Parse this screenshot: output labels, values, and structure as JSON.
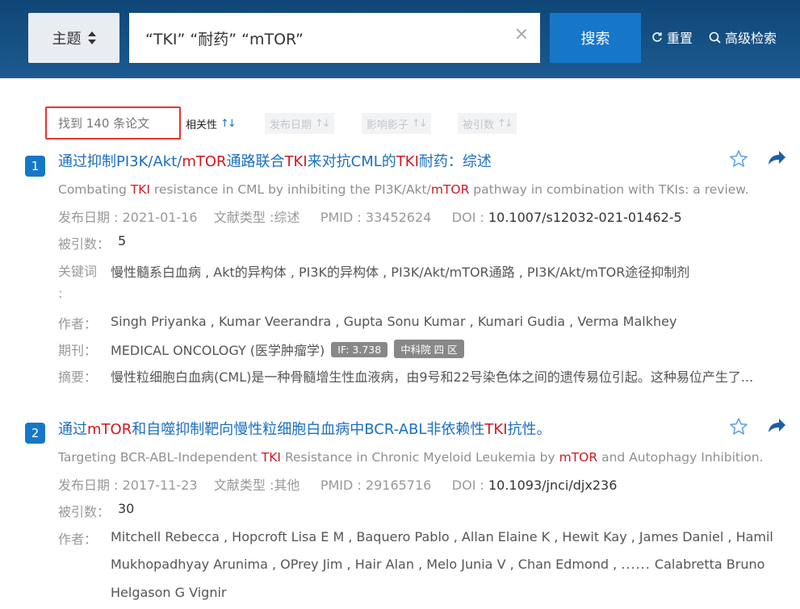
{
  "header": {
    "field_select": "主题",
    "query": "“TKI” “耐药” “mTOR”",
    "search_button": "搜索",
    "reset": "重置",
    "advanced": "高级检索"
  },
  "results_bar": {
    "count_text": "找到 140 条论文",
    "sorts": [
      {
        "label": "相关性",
        "active": true
      },
      {
        "label": "发布日期",
        "active": false
      },
      {
        "label": "影响影子",
        "active": false
      },
      {
        "label": "被引数",
        "active": false
      }
    ]
  },
  "items": [
    {
      "num": "1",
      "title_parts": [
        "通过抑制PI3K/Akt/",
        "mTOR",
        "通路联合",
        "TKI",
        "来对抗CML的",
        "TKI",
        "耐药：综述"
      ],
      "subtitle_parts": [
        "Combating ",
        "TKI",
        " resistance in CML by inhibiting the PI3K/Akt/",
        "mTOR",
        " pathway in combination with TKIs: a review."
      ],
      "pub_date_label": "发布日期 : ",
      "pub_date": "2021-01-16",
      "doc_type_label": "文献类型 :",
      "doc_type": "综述",
      "pmid_label": "PMID : ",
      "pmid": "33452624",
      "doi_label": "DOI : ",
      "doi": "10.1007/s12032-021-01462-5",
      "cited_label": "被引数：",
      "cited": "5",
      "keywords_label": "关键词",
      "keywords_colon": ":",
      "keywords": "慢性髓系白血病 , Akt的异构体 , PI3K的异构体 , PI3K/Akt/mTOR通路 , PI3K/Akt/mTOR途径抑制剂",
      "authors_label": "作者：",
      "authors": "Singh Priyanka , Kumar Veerandra , Gupta Sonu Kumar , Kumari Gudia , Verma Malkhey",
      "journal_label": "期刊：",
      "journal": "MEDICAL ONCOLOGY (医学肿瘤学)",
      "tag_if": "IF: 3.738",
      "tag_cas": "中科院 四 区",
      "abstract_label": "摘要：",
      "abstract": "慢性粒细胞白血病(CML)是一种骨髓增生性血液病，由9号和22号染色体之间的遗传易位引起。这种易位产生了..."
    },
    {
      "num": "2",
      "title_parts": [
        "通过",
        "mTOR",
        "和自噬抑制靶向慢性粒细胞白血病中BCR-ABL非依赖性",
        "TKI",
        "抗性。"
      ],
      "subtitle_parts": [
        "Targeting BCR-ABL-Independent ",
        "TKI",
        " Resistance in Chronic Myeloid Leukemia by ",
        "mTOR",
        " and Autophagy Inhibition."
      ],
      "pub_date_label": "发布日期 : ",
      "pub_date": "2017-11-23",
      "doc_type_label": "文献类型 :",
      "doc_type": "其他",
      "pmid_label": "PMID : ",
      "pmid": "29165716",
      "doi_label": "DOI : ",
      "doi": "10.1093/jnci/djx236",
      "cited_label": "被引数：",
      "cited": "30",
      "authors_label": "作者：",
      "authors_line1": "Mitchell Rebecca , Hopcroft Lisa E M , Baquero Pablo , Allan Elaine K , Hewit Kay , James Daniel , Hamil",
      "authors_line2_a": "Mukhopadhyay Arunima , OPrey Jim , Hair Alan , Melo Junia V , Chan Edmond , ",
      "authors_ellipsis": "......",
      "authors_line2_b": "  Calabretta Bruno",
      "authors_line3": "Helgason G Vignir"
    }
  ]
}
